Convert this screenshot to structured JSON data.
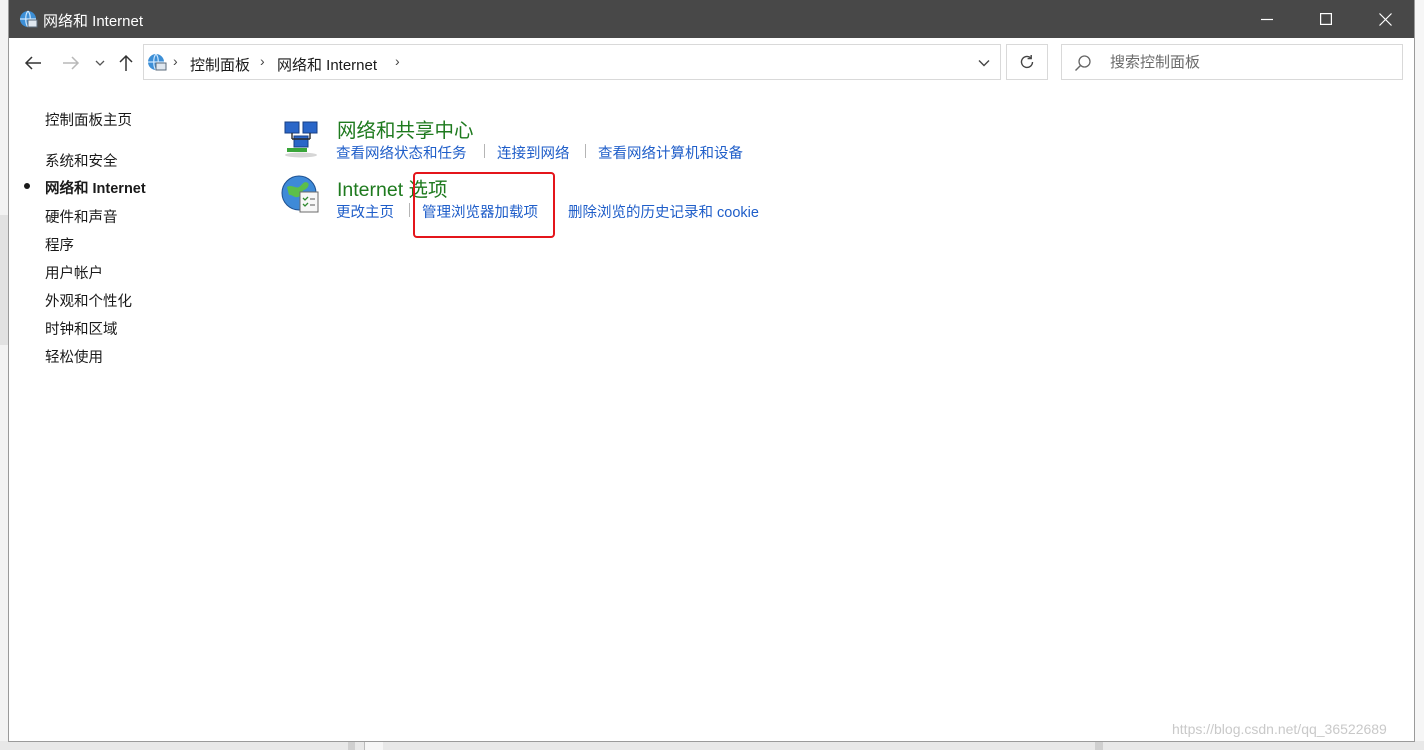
{
  "window": {
    "title": "网络和 Internet"
  },
  "navigation": {
    "breadcrumbs": [
      "控制面板",
      "网络和 Internet"
    ],
    "search_placeholder": "搜索控制面板"
  },
  "sidebar": {
    "home": "控制面板主页",
    "items": [
      {
        "label": "系统和安全",
        "active": false
      },
      {
        "label": "网络和 Internet",
        "active": true
      },
      {
        "label": "硬件和声音",
        "active": false
      },
      {
        "label": "程序",
        "active": false
      },
      {
        "label": "用户帐户",
        "active": false
      },
      {
        "label": "外观和个性化",
        "active": false
      },
      {
        "label": "时钟和区域",
        "active": false
      },
      {
        "label": "轻松使用",
        "active": false
      }
    ]
  },
  "categories": [
    {
      "title": "网络和共享中心",
      "links": [
        "查看网络状态和任务",
        "连接到网络",
        "查看网络计算机和设备"
      ]
    },
    {
      "title": "Internet 选项",
      "links": [
        "更改主页",
        "管理浏览器加载项",
        "删除浏览的历史记录和 cookie"
      ]
    }
  ],
  "annotation": {
    "highlighted_link": "管理浏览器加载项",
    "color": "#e4151b"
  },
  "watermark": "https://blog.csdn.net/qq_36522689",
  "colors": {
    "titlebar": "#484848",
    "link": "#1f5ec9",
    "category_title": "#1e7a1e"
  }
}
